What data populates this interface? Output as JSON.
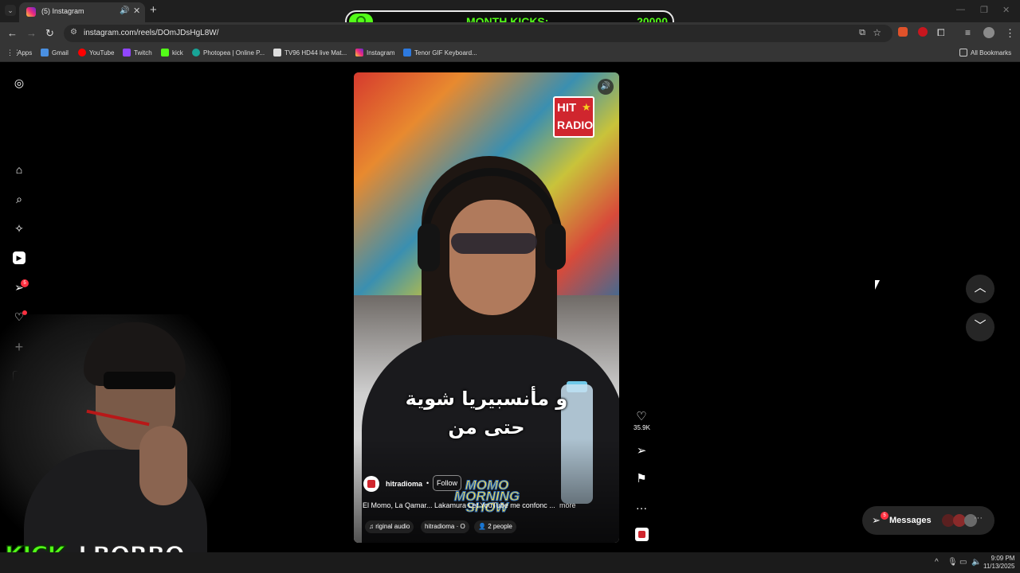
{
  "browser": {
    "tab_title": "(5) Instagram",
    "url": "instagram.com/reels/DOmJDsHgL8W/",
    "bookmarks": [
      "Apps",
      "Gmail",
      "YouTube",
      "Twitch",
      "kick",
      "Photopea | Online P...",
      "TV96 HD44 live Mat...",
      "Instagram",
      "Tenor GIF Keyboard..."
    ],
    "all_bookmarks": "All Bookmarks"
  },
  "kicks_overlay": {
    "label": "MONTH KICKS:",
    "value": "20000"
  },
  "sidebar": {
    "notifications_badge": "5"
  },
  "reel": {
    "subtitle_line1": "و مأنسبيريا شوية",
    "subtitle_line2": "حتى من",
    "logo_line1": "HIT",
    "logo_line2": "RADIO",
    "overlay_brand": "MOMO MORNING SHOW",
    "username": "hitradioma",
    "separator": "•",
    "follow": "Follow",
    "caption": "El Momo, La Qamar... Lakamura Let YouTube me confonc ...",
    "more": "more",
    "audio": "riginal audio",
    "audio_user": "hitradioma · O",
    "people": "2 people"
  },
  "actions": {
    "likes": "35.9K"
  },
  "messages": {
    "label": "Messages",
    "badge": "5"
  },
  "stream": {
    "brand_kick": "KICK",
    "brand_name": "LBORBO"
  },
  "taskbar": {
    "time": "9:09 PM",
    "date": "11/13/2025"
  },
  "colors": {
    "kick_green": "#53fc18",
    "badge_red": "#ff3040",
    "chrome_dark": "#353535"
  }
}
